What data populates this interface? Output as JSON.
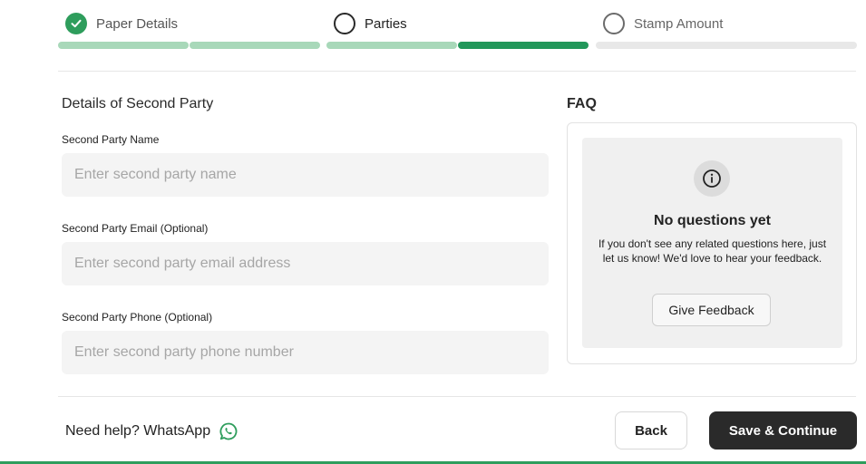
{
  "stepper": {
    "steps": [
      {
        "label": "Paper Details",
        "state": "completed",
        "icon": "check-icon"
      },
      {
        "label": "Parties",
        "state": "active"
      },
      {
        "label": "Stamp Amount",
        "state": "pending"
      }
    ],
    "colors": {
      "complete": "#2e9d5c",
      "progress_light": "#a8d8b9",
      "progress_dark": "#22975a",
      "pending": "#e8e8e8"
    }
  },
  "form": {
    "section_title": "Details of Second Party",
    "fields": [
      {
        "label": "Second Party Name",
        "placeholder": "Enter second party name",
        "value": ""
      },
      {
        "label": "Second Party Email (Optional)",
        "placeholder": "Enter second party email address",
        "value": ""
      },
      {
        "label": "Second Party Phone (Optional)",
        "placeholder": "Enter second party phone number",
        "value": ""
      }
    ]
  },
  "faq": {
    "title": "FAQ",
    "icon": "info-icon",
    "empty_title": "No questions yet",
    "empty_text": "If you don't see any related questions here, just let us know! We'd love to hear your feedback.",
    "feedback_button": "Give Feedback"
  },
  "footer": {
    "help_text": "Need help? WhatsApp",
    "help_icon": "whatsapp-icon",
    "back_button": "Back",
    "save_button": "Save & Continue"
  }
}
